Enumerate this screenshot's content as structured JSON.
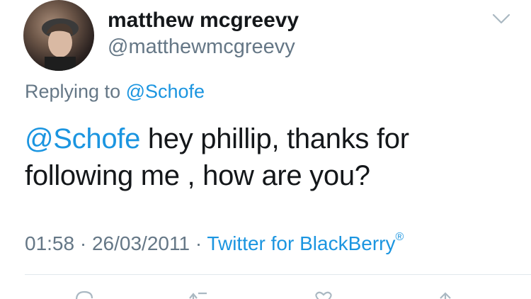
{
  "user": {
    "display_name": "matthew mcgreevy",
    "handle": "@matthewmcgreevy"
  },
  "reply_context": {
    "prefix": "Replying to",
    "mention": "@Schofe"
  },
  "tweet": {
    "mention": "@Schofe",
    "text": " hey phillip, thanks for following me , how are you?"
  },
  "meta": {
    "time": "01:58",
    "separator": "·",
    "date": "26/03/2011",
    "client": "Twitter for BlackBerry",
    "client_mark": "®"
  },
  "icons": {
    "menu": "chevron-down-icon",
    "actions": [
      "reply-icon",
      "retweet-icon",
      "like-icon",
      "share-icon"
    ]
  },
  "colors": {
    "link": "#1b95e0",
    "secondary_text": "#657786",
    "primary_text": "#14171a",
    "divider": "#e1e8ed"
  }
}
